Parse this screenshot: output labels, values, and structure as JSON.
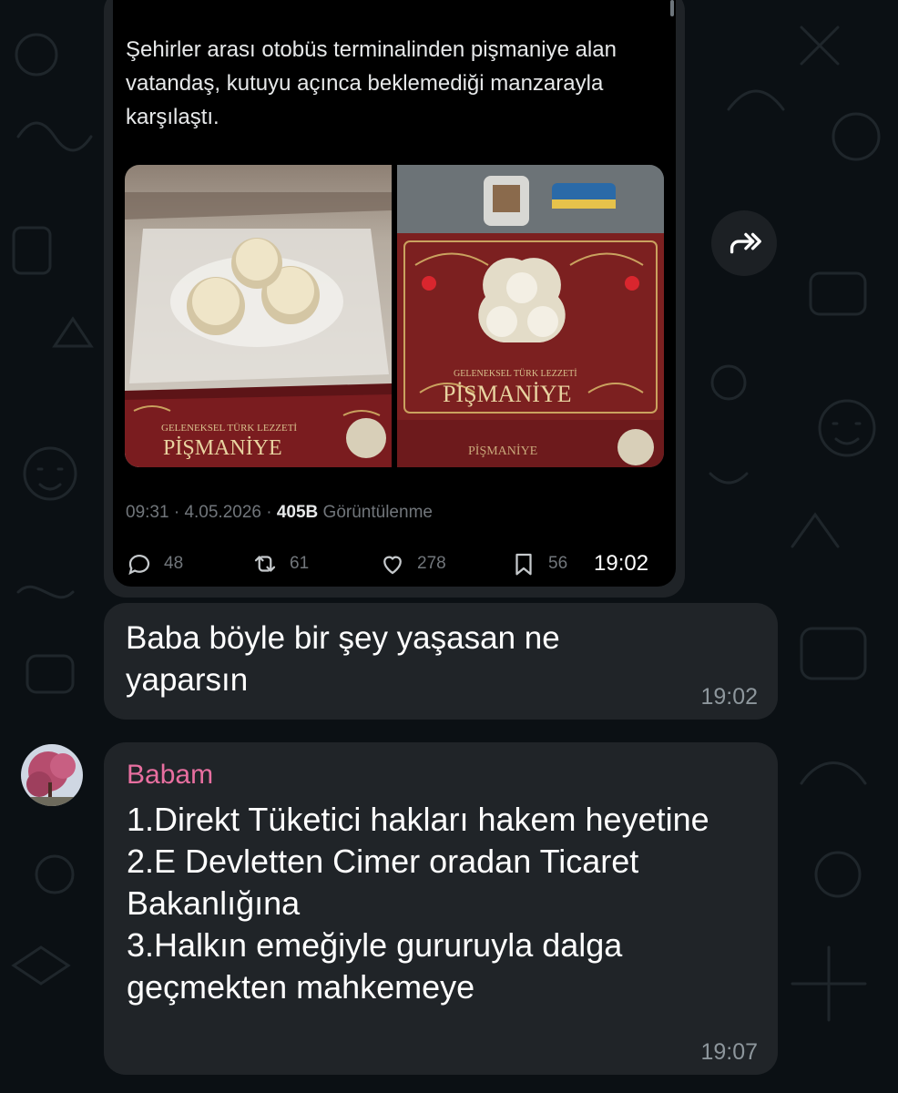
{
  "theme": {
    "background": "#0b1014",
    "bubble": "#202428",
    "sender_color": "#e86fa0",
    "tweet_card": "#000000"
  },
  "tweet": {
    "text": "Şehirler arası otobüs terminalinden pişmaniye alan vatandaş, kutuyu açınca beklemediği manzarayla karşılaştı.",
    "photo_left": {
      "brand_small": "GELENEKSEL TÜRK LEZZETİ",
      "brand_big": "PİŞMANİYE"
    },
    "photo_right": {
      "brand_small": "GELENEKSEL TÜRK LEZZETİ",
      "brand_big": "PİŞMANİYE",
      "brand_bottom": "PİŞMANİYE"
    },
    "meta": {
      "time": "09:31",
      "sep1": " · ",
      "date": "4.05.2026",
      "sep2": " · ",
      "views": "405B",
      "views_label": " Görüntülenme"
    },
    "stats": {
      "replies": "48",
      "retweets": "61",
      "likes": "278",
      "bookmarks": "56"
    },
    "message_time": "19:02",
    "icons": [
      "reply-icon",
      "retweet-icon",
      "like-icon",
      "bookmark-icon",
      "forward-icon"
    ]
  },
  "messages": [
    {
      "text": "Baba böyle bir şey yaşasan ne yaparsın",
      "time": "19:02"
    },
    {
      "sender": "Babam",
      "text": "1.Direkt Tüketici hakları hakem heyetine\n2.E Devletten Cimer oradan Ticaret Bakanlığına\n3.Halkın emeğiyle gururuyla dalga geçmekten mahkemeye",
      "time": "19:07"
    }
  ]
}
